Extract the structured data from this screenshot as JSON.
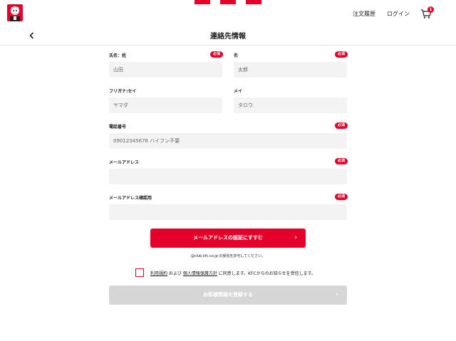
{
  "header": {
    "order_history": "注文履歴",
    "login": "ログイン",
    "cart_count": "1",
    "brand_color": "#e4002b"
  },
  "title": "連絡先情報",
  "form": {
    "required_badge": "必須",
    "last_name": {
      "label": "氏名：姓",
      "placeholder": "山田"
    },
    "first_name": {
      "label": "名",
      "placeholder": "太郎"
    },
    "kana_last": {
      "label": "フリガナ:セイ",
      "placeholder": "ヤマダ"
    },
    "kana_first": {
      "label": "メイ",
      "placeholder": "タロウ"
    },
    "phone": {
      "label": "電話番号",
      "placeholder": "09012345678 ハイフン不要"
    },
    "email": {
      "label": "メールアドレス",
      "placeholder": ""
    },
    "email_confirm": {
      "label": "メールアドレス確認用",
      "placeholder": ""
    }
  },
  "verify_button": "メールアドレスの認証にすすむ",
  "domain_note": "@club.kfc.co.jp の受信を許可してください。",
  "agreement": {
    "terms": "利用規約",
    "and": " および ",
    "privacy": "個人情報保護方針",
    "rest": " に同意します。KFCからのお知らせを受信します。"
  },
  "register_button": "お客様情報を登録する"
}
